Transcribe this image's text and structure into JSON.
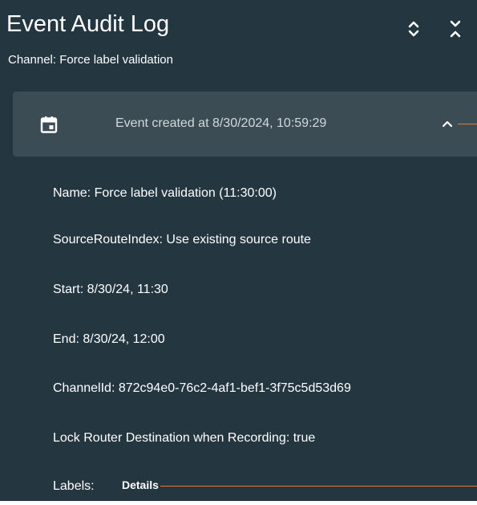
{
  "header": {
    "title": "Event Audit Log",
    "subtitle": "Channel: Force label validation",
    "expand_icon": "unfold-more-icon",
    "collapse_icon": "unfold-less-icon"
  },
  "event": {
    "icon": "calendar-icon",
    "title": "Event created at 8/30/2024, 10:59:29",
    "chevron_icon": "chevron-up-icon"
  },
  "details": [
    "Name: Force label validation (11:30:00)",
    "SourceRouteIndex: Use existing source route",
    "Start: 8/30/24, 11:30",
    "End: 8/30/24, 12:00",
    "ChannelId: 872c94e0-76c2-4af1-bef1-3f75c5d53d69",
    "Lock Router Destination when Recording: true"
  ],
  "labels": {
    "label": "Labels:",
    "value": "Details"
  },
  "colors": {
    "background": "#243640",
    "card": "#3c4c55",
    "connector": "#e07b39",
    "text": "#ffffff"
  }
}
